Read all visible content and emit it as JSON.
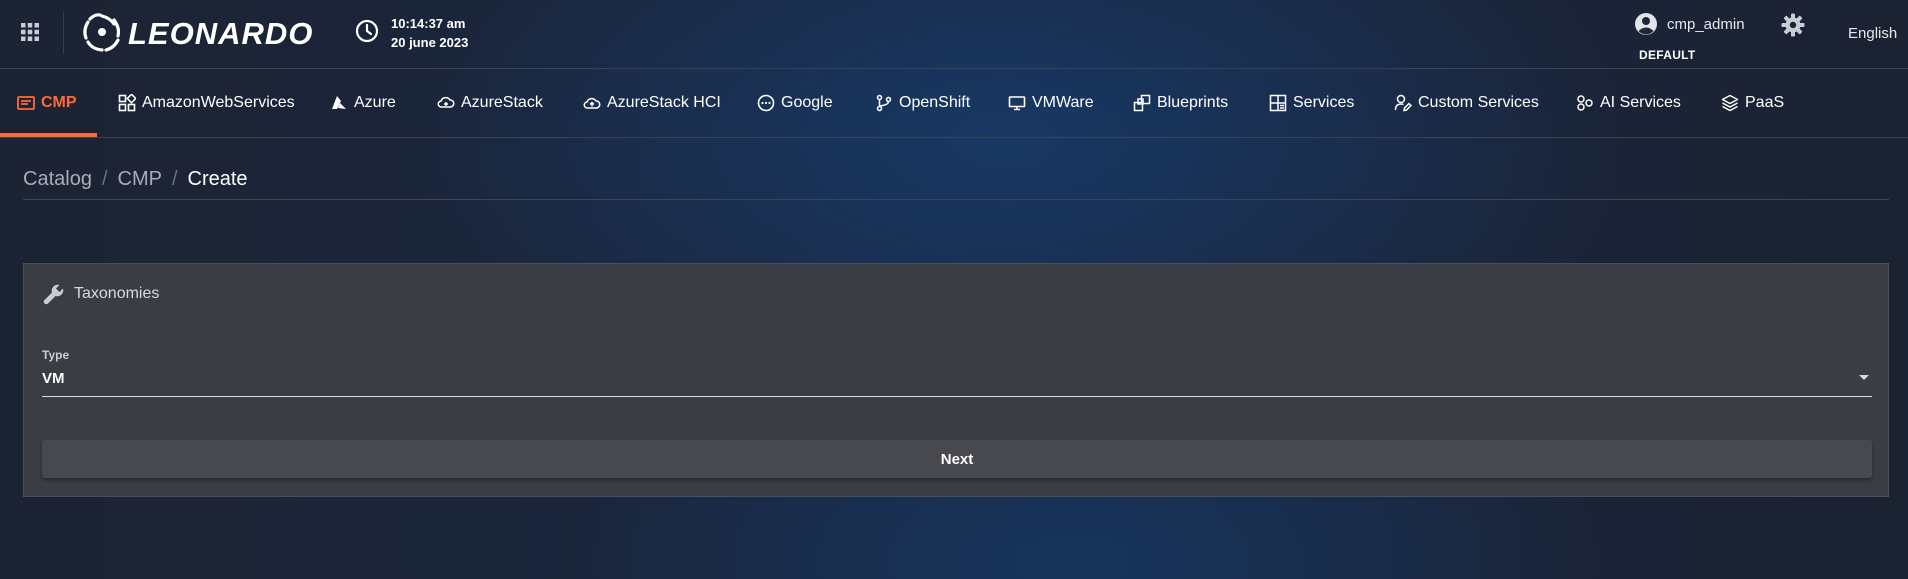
{
  "app": {
    "logo_text": "LEONARDO",
    "clock": {
      "time": "10:14:37 am",
      "date": "20 june 2023"
    },
    "user": {
      "name": "cmp_admin",
      "tenant": "DEFAULT"
    },
    "language": "English"
  },
  "nav": {
    "items": [
      {
        "label": "CMP",
        "icon": "cmp-icon",
        "active": true
      },
      {
        "label": "AmazonWebServices",
        "icon": "aws-icon"
      },
      {
        "label": "Azure",
        "icon": "azure-icon"
      },
      {
        "label": "AzureStack",
        "icon": "azurestack-icon"
      },
      {
        "label": "AzureStack HCI",
        "icon": "cloud-upload-icon"
      },
      {
        "label": "Google",
        "icon": "google-icon"
      },
      {
        "label": "OpenShift",
        "icon": "branch-icon"
      },
      {
        "label": "VMWare",
        "icon": "monitor-icon"
      },
      {
        "label": "Blueprints",
        "icon": "blueprints-icon"
      },
      {
        "label": "Services",
        "icon": "services-icon"
      },
      {
        "label": "Custom Services",
        "icon": "user-edit-icon"
      },
      {
        "label": "AI Services",
        "icon": "ai-icon"
      },
      {
        "label": "PaaS",
        "icon": "layers-icon"
      }
    ]
  },
  "breadcrumb": {
    "items": [
      "Catalog",
      "CMP"
    ],
    "current": "Create"
  },
  "form": {
    "section_title": "Taxonomies",
    "type_label": "Type",
    "type_value": "VM",
    "next_label": "Next"
  },
  "colors": {
    "accent": "#ff6b35",
    "card_bg": "#3a3d44",
    "button_bg": "#47494e"
  }
}
